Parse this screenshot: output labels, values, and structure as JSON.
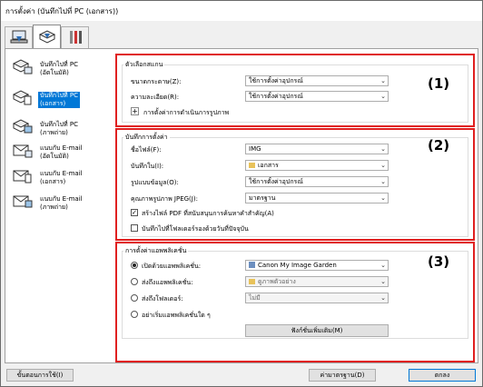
{
  "window": {
    "title": "การตั้งค่า (บันทึกไปที่ PC (เอกสาร))"
  },
  "tabs": [
    {
      "icon": "scan-from-computer-icon"
    },
    {
      "icon": "scan-from-panel-icon"
    },
    {
      "icon": "general-settings-icon"
    }
  ],
  "sidebar": {
    "items": [
      {
        "label1": "บันทึกไปที่ PC",
        "label2": "(อัตโนมัติ)",
        "icon": "pc-auto-icon"
      },
      {
        "label1": "บันทึกไปที่ PC",
        "label2": "(เอกสาร)",
        "icon": "pc-document-icon",
        "selected": true
      },
      {
        "label1": "บันทึกไปที่ PC",
        "label2": "(ภาพถ่าย)",
        "icon": "pc-photo-icon"
      },
      {
        "label1": "แนบกับ E-mail",
        "label2": "(อัตโนมัติ)",
        "icon": "email-auto-icon"
      },
      {
        "label1": "แนบกับ E-mail",
        "label2": "(เอกสาร)",
        "icon": "email-document-icon"
      },
      {
        "label1": "แนบกับ E-mail",
        "label2": "(ภาพถ่าย)",
        "icon": "email-photo-icon"
      }
    ]
  },
  "scan_options": {
    "legend": "ตัวเลือกสแกน",
    "paper_size_label": "ขนาดกระดาษ(Z):",
    "paper_size_value": "ใช้การตั้งค่าอุปกรณ์",
    "resolution_label": "ความละเอียด(R):",
    "resolution_value": "ใช้การตั้งค่าอุปกรณ์",
    "image_processing_label": "การตั้งค่าการดำเนินการรูปภาพ",
    "badge": "(1)"
  },
  "save_settings": {
    "legend": "บันทึกการตั้งค่า",
    "filename_label": "ชื่อไฟล์(F):",
    "filename_value": "IMG",
    "save_in_label": "บันทึกใน(I):",
    "save_in_value": "เอกสาร",
    "data_format_label": "รูปแบบข้อมูล(O):",
    "data_format_value": "ใช้การตั้งค่าอุปกรณ์",
    "jpeg_quality_label": "คุณภาพรูปภาพ JPEG(J):",
    "jpeg_quality_value": "มาตรฐาน",
    "pdf_keyword_label": "สร้างไฟล์ PDF ที่สนับสนุนการค้นหาคำสำคัญ(A)",
    "pdf_keyword_checked": true,
    "subfolder_label": "บันทึกไปที่โฟลเดอร์รองด้วยวันที่ปัจจุบัน",
    "subfolder_checked": false,
    "badge": "(2)"
  },
  "app_settings": {
    "legend": "การตั้งค่าแอพพลิเคชั่น",
    "open_with_label": "เปิดด้วยแอพพลิเคชั่น:",
    "open_with_value": "Canon My Image Garden",
    "send_to_app_label": "ส่งถึงแอพพลิเคชั่น:",
    "send_to_app_value": "ดูภาพตัวอย่าง",
    "send_to_folder_label": "ส่งถึงโฟลเดอร์:",
    "send_to_folder_value": "ไม่มี",
    "no_app_label": "อย่าเริ่มแอพพลิเคชั่นใด ๆ",
    "more_functions_label": "ฟังก์ชั่นเพิ่มเติม(M)",
    "selected_option": "open_with",
    "badge": "(3)"
  },
  "footer": {
    "instructions_label": "ขั้นตอนการใช้(I)",
    "defaults_label": "ค่ามาตรฐาน(D)",
    "ok_label": "ตกลง"
  }
}
